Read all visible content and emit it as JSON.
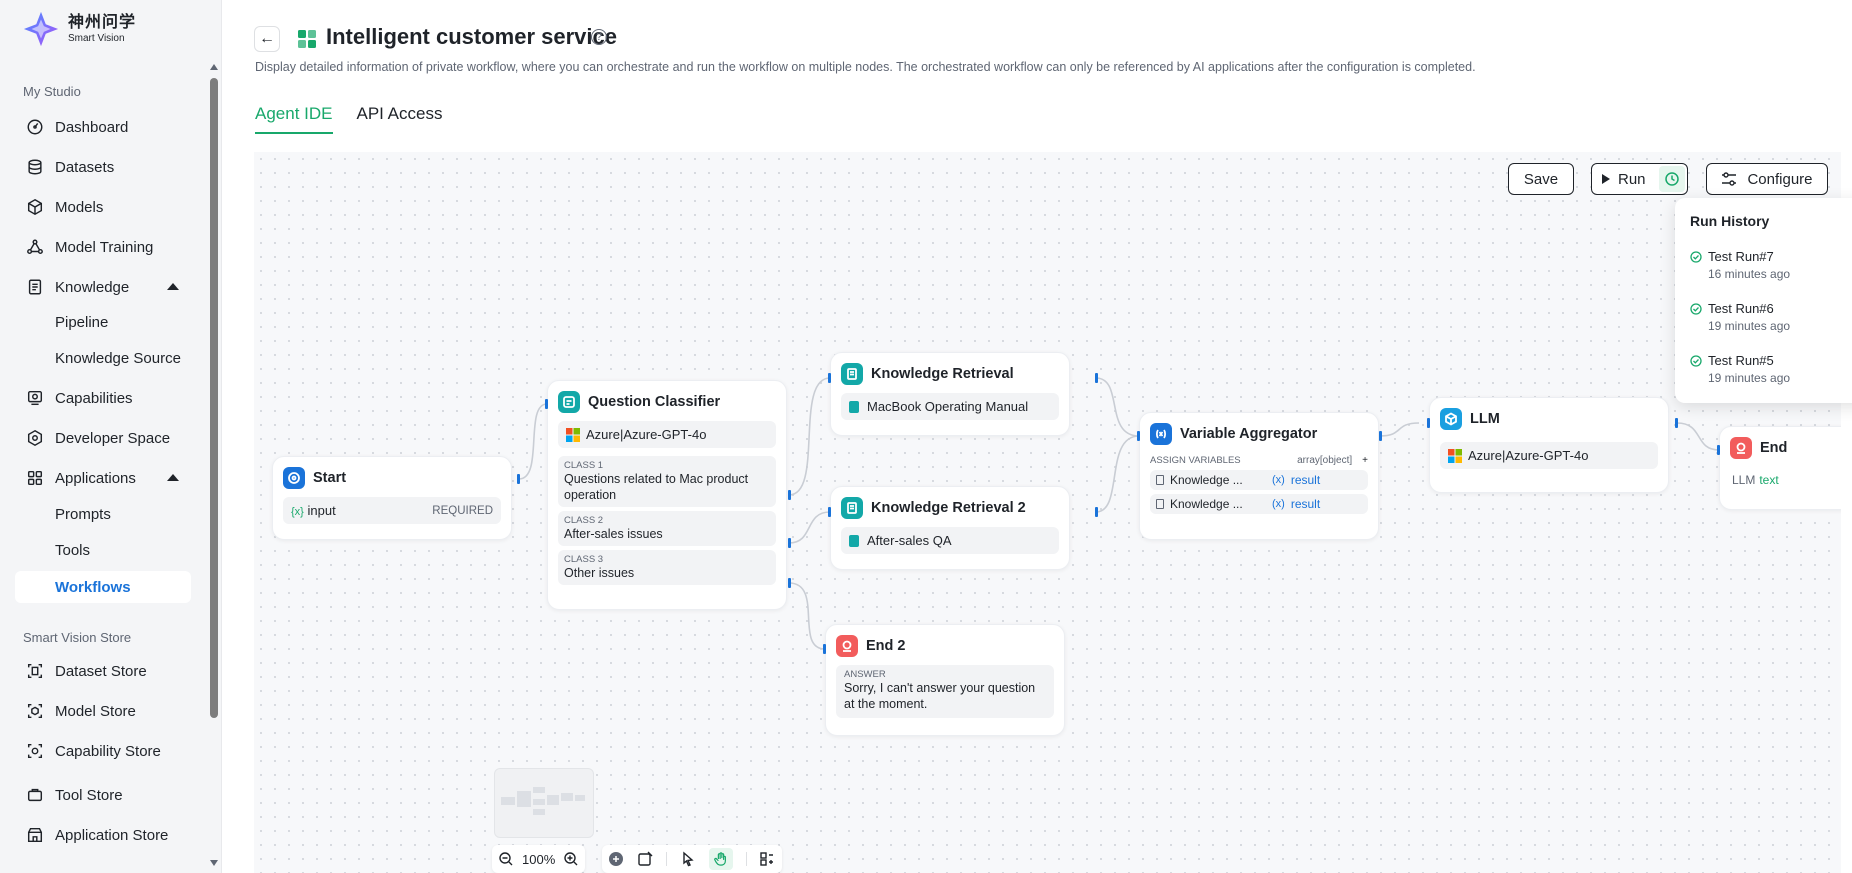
{
  "brand": {
    "cn": "神州问学",
    "en": "Smart Vision"
  },
  "sidebar": {
    "section1": "My Studio",
    "items": [
      {
        "label": "Dashboard",
        "icon": "dashboard-icon"
      },
      {
        "label": "Datasets",
        "icon": "database-icon"
      },
      {
        "label": "Models",
        "icon": "cube-icon"
      },
      {
        "label": "Model Training",
        "icon": "training-icon"
      },
      {
        "label": "Knowledge",
        "icon": "book-icon"
      },
      {
        "label": "Pipeline"
      },
      {
        "label": "Knowledge Source"
      },
      {
        "label": "Capabilities",
        "icon": "capability-icon"
      },
      {
        "label": "Developer Space",
        "icon": "developer-icon"
      },
      {
        "label": "Applications",
        "icon": "grid-icon"
      },
      {
        "label": "Prompts"
      },
      {
        "label": "Tools"
      },
      {
        "label": "Workflows"
      }
    ],
    "section2": "Smart Vision Store",
    "store": [
      {
        "label": "Dataset Store"
      },
      {
        "label": "Model Store"
      },
      {
        "label": "Capability Store"
      },
      {
        "label": "Tool Store"
      },
      {
        "label": "Application Store"
      }
    ]
  },
  "header": {
    "back": "←",
    "title": "Intelligent customer service",
    "help": "?",
    "description": "Display detailed information of private workflow, where you can orchestrate and run the workflow on multiple nodes. The orchestrated workflow can only be referenced by AI applications after the configuration is completed."
  },
  "tabs": [
    {
      "label": "Agent IDE",
      "active": true
    },
    {
      "label": "API Access",
      "active": false
    }
  ],
  "toolbar": {
    "save": "Save",
    "run": "Run",
    "configure": "Configure"
  },
  "run_history": {
    "title": "Run History",
    "close": "×",
    "items": [
      {
        "name": "Test Run#7",
        "time": "16 minutes ago"
      },
      {
        "name": "Test Run#6",
        "time": "19 minutes ago"
      },
      {
        "name": "Test Run#5",
        "time": "19 minutes ago"
      }
    ]
  },
  "nodes": {
    "start": {
      "title": "Start",
      "var_prefix": "{x}",
      "var": "input",
      "required": "REQUIRED"
    },
    "classifier": {
      "title": "Question Classifier",
      "model": "Azure|Azure-GPT-4o",
      "classes": [
        {
          "label": "CLASS 1",
          "text": "Questions related to Mac product operation"
        },
        {
          "label": "CLASS 2",
          "text": "After-sales issues"
        },
        {
          "label": "CLASS 3",
          "text": "Other issues"
        }
      ]
    },
    "kr1": {
      "title": "Knowledge Retrieval",
      "source": "MacBook Operating Manual"
    },
    "kr2": {
      "title": "Knowledge Retrieval 2",
      "source": "After-sales QA"
    },
    "end2": {
      "title": "End 2",
      "label": "ANSWER",
      "answer": "Sorry, I can't answer your question at the moment."
    },
    "aggregator": {
      "title": "Variable Aggregator",
      "assign": "ASSIGN VARIABLES",
      "type": "array[object]",
      "plus": "+",
      "rows": [
        {
          "name": "Knowledge ...",
          "var": "result"
        },
        {
          "name": "Knowledge ...",
          "var": "result"
        }
      ]
    },
    "llm": {
      "title": "LLM",
      "model": "Azure|Azure-GPT-4o"
    },
    "end": {
      "title": "End",
      "var_name": "LLM",
      "var_value": "text"
    }
  },
  "zoom": {
    "level": "100%"
  },
  "colors": {
    "accent": "#18a86b",
    "blue": "#1a73d9",
    "teal": "#13a8a8",
    "red": "#f25c5c"
  }
}
